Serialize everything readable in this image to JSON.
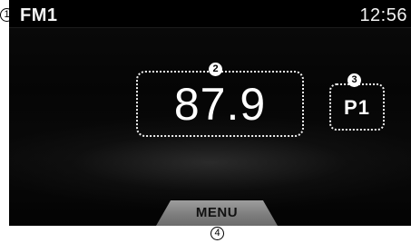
{
  "status_bar": {
    "band": "FM1",
    "time": "12:56"
  },
  "main": {
    "frequency": "87.9",
    "preset": "P1"
  },
  "menu": {
    "label": "MENU"
  },
  "callouts": {
    "one": "①",
    "two": "2",
    "three": "3",
    "four": "④"
  }
}
